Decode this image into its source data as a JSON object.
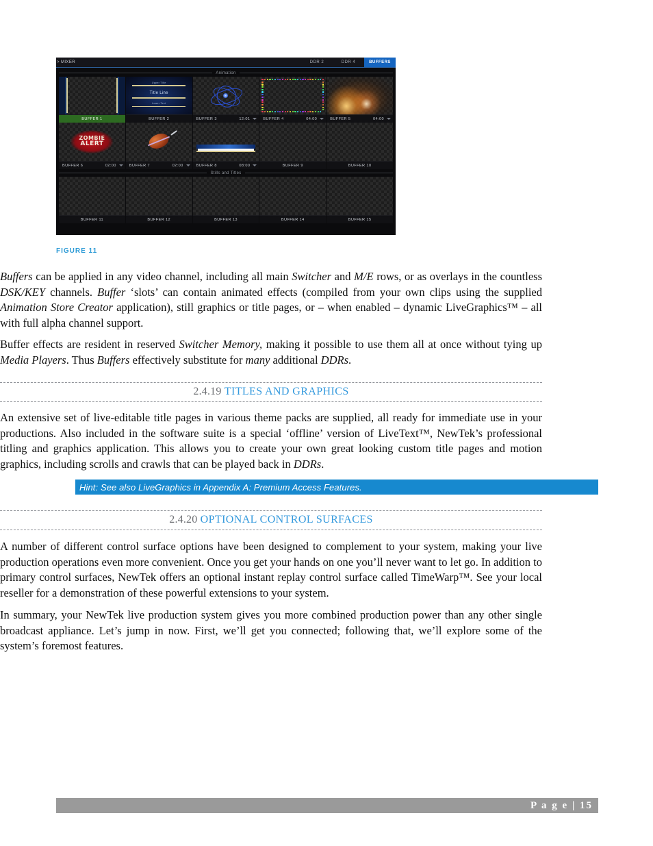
{
  "figure": {
    "caption": "FIGURE 11",
    "app_name": "> MIXER",
    "tabs": [
      {
        "label": "DDR 2",
        "active": false
      },
      {
        "label": "DDR 4",
        "active": false
      },
      {
        "label": "BUFFERS",
        "active": true
      }
    ],
    "group_labels": {
      "animation": "Animation",
      "stills": "Stills and Titles"
    },
    "accent_tab_color": "#1565c0",
    "selected_label_color": "#2d6b21",
    "buffers": [
      {
        "name": "BUFFER 1",
        "time": "",
        "selected": true,
        "art": "bars"
      },
      {
        "name": "BUFFER 2",
        "time": "",
        "selected": false,
        "art": "title",
        "title_main": "Title Line",
        "title_top": "Upper Title",
        "title_sub": "Lower Text"
      },
      {
        "name": "BUFFER 3",
        "time": "12:01",
        "selected": false,
        "art": "globe"
      },
      {
        "name": "BUFFER 4",
        "time": "04:00",
        "selected": false,
        "art": "lights"
      },
      {
        "name": "BUFFER 5",
        "time": "04:00",
        "selected": false,
        "art": "glow"
      },
      {
        "name": "BUFFER 6",
        "time": "02:00",
        "selected": false,
        "art": "zombie",
        "z_line1": "ZOMBIE",
        "z_line2": "ALERT"
      },
      {
        "name": "BUFFER 7",
        "time": "02:00",
        "selected": false,
        "art": "ball"
      },
      {
        "name": "BUFFER 8",
        "time": "08:00",
        "selected": false,
        "art": "lowerthird"
      },
      {
        "name": "BUFFER 9",
        "time": "",
        "selected": false,
        "art": "empty"
      },
      {
        "name": "BUFFER 10",
        "time": "",
        "selected": false,
        "art": "empty"
      },
      {
        "name": "BUFFER 11",
        "time": "",
        "selected": false,
        "art": "empty"
      },
      {
        "name": "BUFFER 12",
        "time": "",
        "selected": false,
        "art": "empty"
      },
      {
        "name": "BUFFER 13",
        "time": "",
        "selected": false,
        "art": "empty"
      },
      {
        "name": "BUFFER 14",
        "time": "",
        "selected": false,
        "art": "empty"
      },
      {
        "name": "BUFFER 15",
        "time": "",
        "selected": false,
        "art": "empty"
      }
    ]
  },
  "sections": {
    "heading_1": {
      "number": "2.4.19",
      "title": "TITLES AND GRAPHICS"
    },
    "heading_2": {
      "number": "2.4.20",
      "title": "OPTIONAL CONTROL SURFACES"
    }
  },
  "hint": {
    "text": "Hint: See also LiveGraphics in Appendix A: Premium Access Features.",
    "background": "#1789cf"
  },
  "paragraphs": {
    "p1": {
      "s1": "Buffers",
      "s2": " can be applied in any video channel, including all main ",
      "s3": "Switcher",
      "s4": " and ",
      "s5": "M/E",
      "s6": " rows, or as overlays in the countless ",
      "s7": "DSK/KEY",
      "s8": " channels.  ",
      "s9": "Buffer",
      "s10": " ‘slots’ can contain animated effects (compiled from your own clips using the supplied ",
      "s11": "Animation Store Creator",
      "s12": " application), still graphics or title pages, or – when enabled – dynamic LiveGraphics™ – all with full alpha channel support."
    },
    "p2": {
      "s1": "Buffer effects are resident in reserved ",
      "s2": "Switcher Memory,",
      "s3": " making it possible to use them all at once without tying up ",
      "s4": "Media Players",
      "s5": ".  Thus ",
      "s6": "Buffers",
      "s7": " effectively substitute for ",
      "s8": "many",
      "s9": " additional ",
      "s10": "DDRs",
      "s11": "."
    },
    "p3": {
      "s1": "An extensive set of live-editable title pages in various theme packs are supplied, all ready for immediate use in your productions.  Also included in the software suite is a special ‘offline’ version of LiveText™, NewTek’s professional titling and graphics application.  This allows you to create your own great looking custom title pages and motion graphics, including scrolls and crawls that can be played back in ",
      "s2": "DDRs",
      "s3": "."
    },
    "p4": {
      "s1": "A number of different control surface options have been designed to complement to your system, making your live production operations even more convenient.  Once you get your hands on one you’ll never want to let go. In addition to primary control surfaces, NewTek offers an optional instant replay control surface called TimeWarp™.  See your local reseller for a demonstration of these powerful extensions to your system."
    },
    "p5": {
      "s1": "In summary, your NewTek live production system gives you more combined production power than any other single broadcast appliance.  Let’s jump in now.  First, we’ll get you connected; following that, we’ll explore some of the system’s foremost features."
    }
  },
  "footer": {
    "page_label": "P a g e  | 15"
  }
}
